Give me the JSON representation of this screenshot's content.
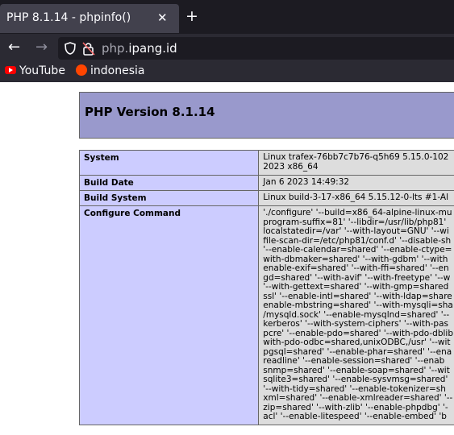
{
  "browser": {
    "tab_title": "PHP 8.1.14 - phpinfo()",
    "tab_close": "✕",
    "new_tab": "+",
    "url_subdomain": "php.",
    "url_domain": "ipang.id",
    "bookmarks": [
      {
        "label": "YouTube"
      },
      {
        "label": "indonesia"
      }
    ]
  },
  "page": {
    "version_heading": "PHP Version 8.1.14",
    "rows": [
      {
        "key": "System",
        "value": "Linux trafex-76bb7c7b76-q5h69 5.15.0-102\n2023 x86_64"
      },
      {
        "key": "Build Date",
        "value": "Jan 6 2023 14:49:32"
      },
      {
        "key": "Build System",
        "value": "Linux build-3-17-x86_64 5.15.12-0-lts #1-Al"
      },
      {
        "key": "Configure Command",
        "value": "'./configure' '--build=x86_64-alpine-linux-mu\nprogram-suffix=81' '--libdir=/usr/lib/php81'\nlocalstatedir=/var' '--with-layout=GNU' '--wi\nfile-scan-dir=/etc/php81/conf.d' '--disable-sh\n'--enable-calendar=shared' '--enable-ctype=\nwith-dbmaker=shared' '--with-gdbm' '--with\nenable-exif=shared' '--with-ffi=shared' '--en\ngd=shared' '--with-avif' '--with-freetype' '--w\n'--with-gettext=shared' '--with-gmp=shared\nssl' '--enable-intl=shared' '--with-ldap=share\nenable-mbstring=shared' '--with-mysqli=sha\n/mysqld.sock' '--enable-mysqlnd=shared' '--\nkerberos' '--with-system-ciphers' '--with-pas\npcre' '--enable-pdo=shared' '--with-pdo-dblib\nwith-pdo-odbc=shared,unixODBC,/usr' '--wit\npgsql=shared' '--enable-phar=shared' '--ena\nreadline' '--enable-session=shared' '--enab\nsnmp=shared' '--enable-soap=shared' '--wit\nsqlite3=shared' '--enable-sysvmsg=shared'\n'--with-tidy=shared' '--enable-tokenizer=sh\nxml=shared' '--enable-xmlreader=shared' '--\nzip=shared' '--with-zlib' '--enable-phpdbg' '-\nacl' '--enable-litespeed' '--enable-embed' 'b"
      }
    ]
  }
}
